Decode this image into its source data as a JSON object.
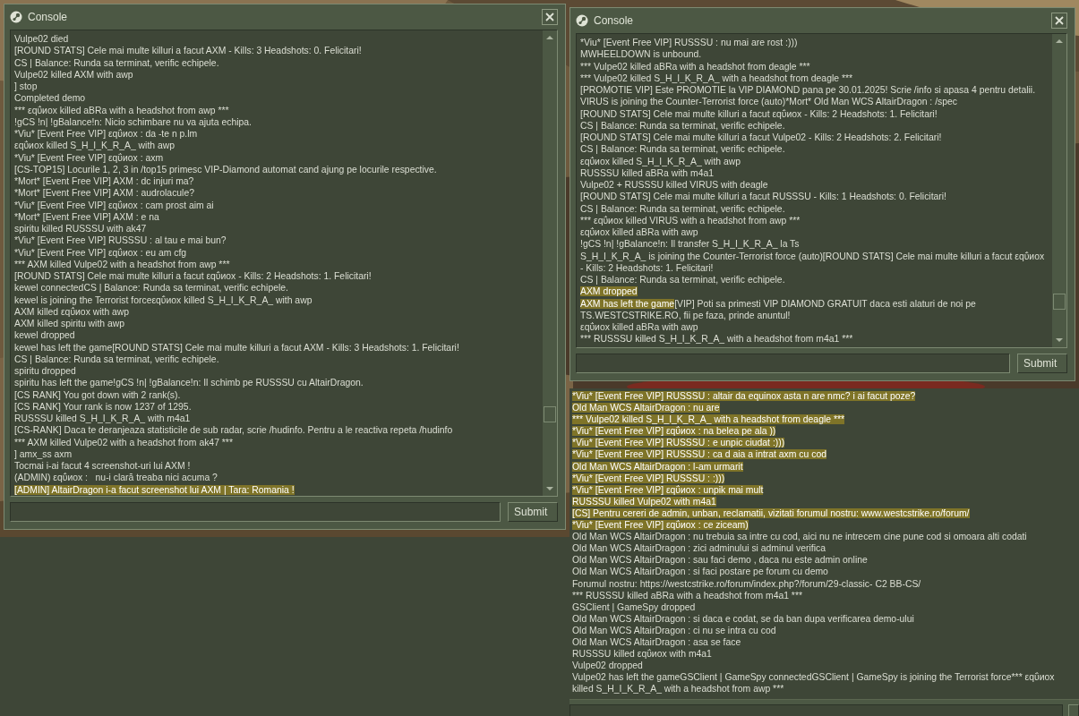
{
  "windows": [
    {
      "title": "Console",
      "submit": "Submit",
      "lines": [
        {
          "text": "Vulpe02 died",
          "highlighted": false
        },
        {
          "text": "[ROUND STATS] Cele mai multe killuri a facut AXM - Kills: 3 Headshots: 0. Felicitari!",
          "highlighted": false
        },
        {
          "text": "CS | Balance: Runda sa terminat, verific echipele.",
          "highlighted": false
        },
        {
          "text": "Vulpe02 killed AXM with awp",
          "highlighted": false
        },
        {
          "text": "] stop",
          "highlighted": false
        },
        {
          "text": "Completed demo",
          "highlighted": false
        },
        {
          "text": "*** εqΰиox killed aBRa with a headshot from awp ***",
          "highlighted": false
        },
        {
          "text": "!gCS !n| !gBalance!n: Nicio schimbare nu va ajuta echipa.",
          "highlighted": false
        },
        {
          "text": "*Viu* [Event Free VIP] εqΰиox : da -te n p.lm",
          "highlighted": false
        },
        {
          "text": "εqΰиox killed S_H_I_K_R_A_ with awp",
          "highlighted": false
        },
        {
          "text": "*Viu* [Event Free VIP] εqΰиox : axm",
          "highlighted": false
        },
        {
          "text": "[CS-TOP15] Locurile 1, 2, 3 in /top15 primesc VIP-Diamond automat cand ajung pe locurile respective.",
          "highlighted": false
        },
        {
          "text": "*Mort* [Event Free VIP] AXM : dc injuri ma?",
          "highlighted": false
        },
        {
          "text": "*Mort* [Event Free VIP] AXM : audrolacule?",
          "highlighted": false
        },
        {
          "text": "*Viu* [Event Free VIP] εqΰиox : cam prost aim ai",
          "highlighted": false
        },
        {
          "text": "*Mort* [Event Free VIP] AXM : e na",
          "highlighted": false
        },
        {
          "text": "spiritu killed RUSSSU with ak47",
          "highlighted": false
        },
        {
          "text": "*Viu* [Event Free VIP] RUSSSU : al tau e mai bun?",
          "highlighted": false
        },
        {
          "text": "*Viu* [Event Free VIP] εqΰиox : eu am cfg",
          "highlighted": false
        },
        {
          "text": "*** AXM killed Vulpe02 with a headshot from awp ***",
          "highlighted": false
        },
        {
          "text": "[ROUND STATS] Cele mai multe killuri a facut εqΰиox - Kills: 2 Headshots: 1. Felicitari!",
          "highlighted": false
        },
        {
          "text": "kewel connectedCS | Balance: Runda sa terminat, verific echipele.",
          "highlighted": false
        },
        {
          "text": "kewel is joining the Terrorist forceεqΰиox killed S_H_I_K_R_A_ with awp",
          "highlighted": false
        },
        {
          "text": "AXM killed εqΰиox with awp",
          "highlighted": false
        },
        {
          "text": "AXM killed spiritu with awp",
          "highlighted": false
        },
        {
          "text": "kewel dropped",
          "highlighted": false
        },
        {
          "text": "kewel has left the game[ROUND STATS] Cele mai multe killuri a facut AXM - Kills: 3 Headshots: 1. Felicitari!",
          "highlighted": false
        },
        {
          "text": "CS | Balance: Runda sa terminat, verific echipele.",
          "highlighted": false
        },
        {
          "text": "spiritu dropped",
          "highlighted": false
        },
        {
          "text": "spiritu has left the game!gCS !n| !gBalance!n: Il schimb pe RUSSSU cu AltairDragon.",
          "highlighted": false
        },
        {
          "text": "[CS RANK] You got down with 2 rank(s).",
          "highlighted": false
        },
        {
          "text": "[CS RANK] Your rank is now 1237 of 1295.",
          "highlighted": false
        },
        {
          "text": "RUSSSU killed S_H_I_K_R_A_ with m4a1",
          "highlighted": false
        },
        {
          "text": "[CS-RANK] Daca te deranjeaza statisticile de sub radar, scrie /hudinfo. Pentru a le reactiva repeta /hudinfo",
          "highlighted": false
        },
        {
          "text": "*** AXM killed Vulpe02 with a headshot from ak47 ***",
          "highlighted": false
        },
        {
          "text": "] amx_ss axm",
          "highlighted": false
        },
        {
          "text": "Tocmai i-ai facut 4 screenshot-uri lui AXM !",
          "highlighted": false
        },
        {
          "text": "(ADMIN) εqΰиox :   nu-i clară treaba nici acuma ?",
          "highlighted": false
        },
        {
          "text": "[ADMIN] AltairDragon i-a facut screenshot lui AXM | Tara: Romania !",
          "highlighted": true
        }
      ]
    },
    {
      "title": "Console",
      "submit": "Submit",
      "lines": [
        {
          "text": "*Viu* [Event Free VIP] RUSSSU : nu mai are rost :)))",
          "highlighted": false
        },
        {
          "text": "MWHEELDOWN is unbound.",
          "highlighted": false
        },
        {
          "text": "*** Vulpe02 killed aBRa with a headshot from deagle ***",
          "highlighted": false
        },
        {
          "text": "*** Vulpe02 killed S_H_I_K_R_A_ with a headshot from deagle ***",
          "highlighted": false
        },
        {
          "text": "[PROMOTIE VIP] Este PROMOTIE la VIP DIAMOND pana pe 30.01.2025! Scrie /info si apasa 4 pentru detalii.",
          "highlighted": false
        },
        {
          "text": "VIRUS is joining the Counter-Terrorist force (auto)*Mort* Old Man WCS AltairDragon : /spec",
          "highlighted": false
        },
        {
          "text": "[ROUND STATS] Cele mai multe killuri a facut εqΰиox - Kills: 2 Headshots: 1. Felicitari!",
          "highlighted": false
        },
        {
          "text": "CS | Balance: Runda sa terminat, verific echipele.",
          "highlighted": false
        },
        {
          "text": "[ROUND STATS] Cele mai multe killuri a facut Vulpe02 - Kills: 2 Headshots: 2. Felicitari!",
          "highlighted": false
        },
        {
          "text": "CS | Balance: Runda sa terminat, verific echipele.",
          "highlighted": false
        },
        {
          "text": "εqΰиox killed S_H_I_K_R_A_ with awp",
          "highlighted": false
        },
        {
          "text": "RUSSSU killed aBRa with m4a1",
          "highlighted": false
        },
        {
          "text": "Vulpe02 + RUSSSU killed VIRUS with deagle",
          "highlighted": false
        },
        {
          "text": "[ROUND STATS] Cele mai multe killuri a facut RUSSSU - Kills: 1 Headshots: 0. Felicitari!",
          "highlighted": false
        },
        {
          "text": "CS | Balance: Runda sa terminat, verific echipele.",
          "highlighted": false
        },
        {
          "text": "*** εqΰиox killed VIRUS with a headshot from awp ***",
          "highlighted": false
        },
        {
          "text": "εqΰиox killed aBRa with awp",
          "highlighted": false
        },
        {
          "text": "!gCS !n| !gBalance!n: Il transfer S_H_I_K_R_A_ la Ts",
          "highlighted": false
        },
        {
          "text": "S_H_I_K_R_A_ is joining the Counter-Terrorist force (auto)[ROUND STATS] Cele mai multe killuri a facut εqΰиox - Kills: 2 Headshots: 1. Felicitari!",
          "highlighted": false
        },
        {
          "text": "CS | Balance: Runda sa terminat, verific echipele.",
          "highlighted": false
        },
        {
          "text": "AXM dropped",
          "highlighted": true
        },
        {
          "text": "AXM has left the game",
          "highlighted": true,
          "continuation": "[VIP] Poti sa primesti VIP DIAMOND GRATUIT daca esti alaturi de noi pe TS.WESTCSTRIKE.RO, fii pe faza, prinde anuntul!"
        },
        {
          "text": "εqΰиox killed aBRa with awp",
          "highlighted": false
        },
        {
          "text": "*** RUSSSU killed S_H_I_K_R_A_ with a headshot from m4a1 ***",
          "highlighted": false
        }
      ]
    }
  ],
  "lower_console": {
    "lines": [
      {
        "text": "*Viu* [Event Free VIP] RUSSSU : altair da equinox asta n are nmc? i ai facut poze?",
        "highlighted": true
      },
      {
        "text": "Old Man WCS AltairDragon : nu are",
        "highlighted": true
      },
      {
        "text": "*** Vulpe02 killed S_H_I_K_R_A_ with a headshot from deagle ***",
        "highlighted": true
      },
      {
        "text": "*Viu* [Event Free VIP] εqΰиox : na belea pe ala ))",
        "highlighted": true
      },
      {
        "text": "*Viu* [Event Free VIP] RUSSSU : e unpic ciudat :)))",
        "highlighted": true
      },
      {
        "text": "*Viu* [Event Free VIP] RUSSSU : ca d aia a intrat axm cu cod",
        "highlighted": true
      },
      {
        "text": "Old Man WCS AltairDragon : l-am urmarit",
        "highlighted": true
      },
      {
        "text": "*Viu* [Event Free VIP] RUSSSU : :)))",
        "highlighted": true
      },
      {
        "text": "*Viu* [Event Free VIP] εqΰиox : unpik mai mult",
        "highlighted": true
      },
      {
        "text": "RUSSSU killed Vulpe02 with m4a1",
        "highlighted": true
      },
      {
        "text": "[CS] Pentru cereri de admin, unban, reclamatii, vizitati forumul nostru: www.westcstrike.ro/forum/",
        "highlighted": true
      },
      {
        "text": "*Viu* [Event Free VIP] εqΰиox : ce ziceam)",
        "highlighted": true
      },
      {
        "text": "Old Man WCS AltairDragon : nu trebuia sa intre cu cod, aici nu ne intrecem cine pune cod si omoara alti codati",
        "highlighted": false
      },
      {
        "text": "Old Man WCS AltairDragon : zici adminului si adminul verifica",
        "highlighted": false
      },
      {
        "text": "Old Man WCS AltairDragon : sau faci demo , daca nu este admin online",
        "highlighted": false
      },
      {
        "text": "Old Man WCS AltairDragon : si faci postare pe forum cu demo",
        "highlighted": false
      },
      {
        "text": "Forumul nostru: https://westcstrike.ro/forum/index.php?/forum/29-classic- C2 BB-CS/",
        "highlighted": false
      },
      {
        "text": "*** RUSSSU killed aBRa with a headshot from m4a1 ***",
        "highlighted": false
      },
      {
        "text": "GSClient | GameSpy dropped",
        "highlighted": false
      },
      {
        "text": "Old Man WCS AltairDragon : si daca e codat, se da ban dupa verificarea demo-ului",
        "highlighted": false
      },
      {
        "text": "Old Man WCS AltairDragon : ci nu se intra cu cod",
        "highlighted": false
      },
      {
        "text": "Old Man WCS AltairDragon : asa se face",
        "highlighted": false
      },
      {
        "text": "RUSSSU killed εqΰиox with m4a1",
        "highlighted": false
      },
      {
        "text": "Vulpe02 dropped",
        "highlighted": false
      },
      {
        "text": "Vulpe02 has left the gameGSClient | GameSpy connectedGSClient | GameSpy is joining the Terrorist force*** εqΰиox killed S_H_I_K_R_A_ with a headshot from awp ***",
        "highlighted": false
      }
    ]
  }
}
